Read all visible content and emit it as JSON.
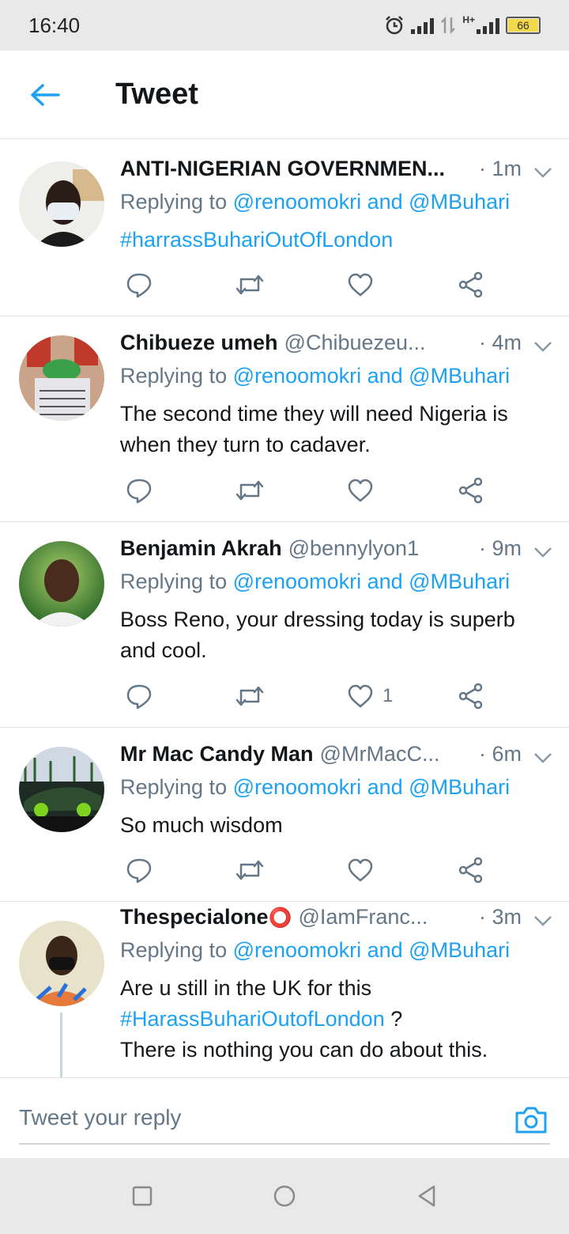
{
  "status": {
    "time": "16:40",
    "battery": "66",
    "network": "H+"
  },
  "header": {
    "title": "Tweet"
  },
  "tweets": [
    {
      "name": "ANTI-NIGERIAN GOVERNMEN...",
      "handle": "",
      "time": "· 1m",
      "reply_prefix": "Replying to",
      "mention1": "@renoomokri",
      "and": "and",
      "mention2": "@MBuhari",
      "text": "",
      "hashtag": "#harrassBuhariOutOfLondon",
      "like_count": ""
    },
    {
      "name": "Chibueze umeh",
      "handle": "@Chibuezeu...",
      "time": "· 4m",
      "reply_prefix": "Replying to",
      "mention1": "@renoomokri",
      "and": "and",
      "mention2": "@MBuhari",
      "text": "The second time they will need Nigeria is when they turn to cadaver.",
      "hashtag": "",
      "like_count": ""
    },
    {
      "name": "Benjamin Akrah",
      "handle": "@bennylyon1",
      "time": "· 9m",
      "reply_prefix": "Replying to",
      "mention1": "@renoomokri",
      "and": "and",
      "mention2": "@MBuhari",
      "text": "Boss Reno, your dressing today is superb and cool.",
      "hashtag": "",
      "like_count": "1"
    },
    {
      "name": "Mr Mac Candy Man",
      "handle": "@MrMacC...",
      "time": "· 6m",
      "reply_prefix": "Replying to",
      "mention1": "@renoomokri",
      "and": "and",
      "mention2": "@MBuhari",
      "text": "So much wisdom",
      "hashtag": "",
      "like_count": ""
    },
    {
      "name": "Thespecialone",
      "name_badge": "⭕",
      "handle": "@IamFranc...",
      "time": "· 3m",
      "reply_prefix": "Replying to",
      "mention1": "@renoomokri",
      "and": "and",
      "mention2": "@MBuhari",
      "text_before": "Are u still in the UK for this",
      "hashtag": "#HarassBuhariOutofLondon",
      "text_after_hashtag": " ?",
      "text_tail": "There is nothing you can do about this.",
      "like_count": ""
    }
  ],
  "reply_bar": {
    "placeholder": "Tweet your reply"
  },
  "colors": {
    "accent": "#1da1f2",
    "secondary_text": "#657786",
    "divider": "#dfe3e6",
    "battery": "#f3d94a"
  },
  "icons": [
    "back-arrow-icon",
    "reply-icon",
    "retweet-icon",
    "like-icon",
    "share-icon",
    "caret-down-icon",
    "camera-icon",
    "nav-square-icon",
    "nav-circle-icon",
    "nav-back-icon"
  ]
}
